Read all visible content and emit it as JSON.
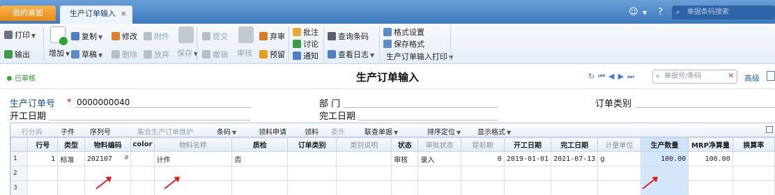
{
  "tabs": {
    "home": "我的桌面",
    "active": "生产订单输入",
    "close": "×"
  },
  "topbar": {
    "search_placeholder": "单据条码搜索"
  },
  "toolbar": {
    "print": "打印",
    "export": "输出",
    "add": "增加",
    "copy": "复制",
    "draft": "草稿",
    "edit": "修改",
    "delete": "删除",
    "attach": "附件",
    "release": "放弃",
    "save": "保存",
    "submit": "提交",
    "revoke": "撤销",
    "audit": "审核",
    "abandon": "弃审",
    "alert": "预留",
    "approve": "批注",
    "discuss": "讨论",
    "notify": "通知",
    "query_barcode": "查询条码",
    "view_log": "查看日志",
    "format_settings": "格式设置",
    "save_format": "保存格式",
    "print_template": "生产订单输入打印"
  },
  "titlebar": {
    "status": "已审核",
    "title": "生产订单输入",
    "bill_search_placeholder": "单据号/条码",
    "advanced": "高级"
  },
  "form": {
    "order_no_label": "生产订单号",
    "order_no_required": "*",
    "order_no": "0000000040",
    "dept_label": "部  门",
    "type_label": "订单类别",
    "start_date_label": "开工日期",
    "finish_date_label": "完工日期"
  },
  "grid_tools": [
    "行分拆",
    "子件",
    "序列号",
    "集合生产订单维护",
    "条码",
    "领料申请",
    "领料",
    "委外",
    "联查单据",
    "排序定位",
    "显示格式"
  ],
  "columns": [
    "行号",
    "类型",
    "物料编码",
    "color",
    "物料名称",
    "质检",
    "订单类别",
    "类别说明",
    "状态",
    "审批状态",
    "提前期",
    "开工日期",
    "完工日期",
    "计量单位",
    "生产数量",
    "MRP净算量",
    "换算率"
  ],
  "rows": [
    {
      "rn": "1",
      "cells": [
        "1",
        "标准",
        "202107",
        "",
        "计件",
        "否",
        "",
        "",
        "审核",
        "录入",
        "0",
        "2019-01-01",
        "2021-07-13",
        "g",
        "100.00",
        "100.00",
        ""
      ]
    },
    {
      "rn": "2",
      "cells": [
        "",
        "",
        "",
        "",
        "",
        "",
        "",
        "",
        "",
        "",
        "",
        "",
        "",
        "",
        "",
        "",
        ""
      ]
    },
    {
      "rn": "3",
      "cells": [
        "",
        "",
        "",
        "",
        "",
        "",
        "",
        "",
        "",
        "",
        "",
        "",
        "",
        "",
        "",
        "",
        ""
      ]
    }
  ]
}
